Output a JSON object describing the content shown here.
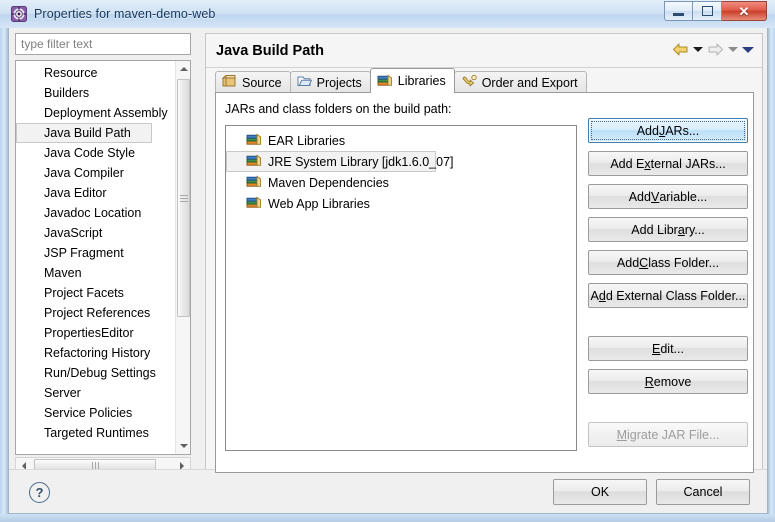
{
  "window": {
    "title": "Properties for maven-demo-web",
    "icon": "properties-gear-icon",
    "minimize_label": "–",
    "maximize_label": "□",
    "close_label": "✕"
  },
  "sidebar": {
    "filter_placeholder": "type filter text",
    "filter_value": "",
    "selected": "Java Build Path",
    "items": [
      {
        "label": "Resource"
      },
      {
        "label": "Builders"
      },
      {
        "label": "Deployment Assembly"
      },
      {
        "label": "Java Build Path"
      },
      {
        "label": "Java Code Style"
      },
      {
        "label": "Java Compiler"
      },
      {
        "label": "Java Editor"
      },
      {
        "label": "Javadoc Location"
      },
      {
        "label": "JavaScript"
      },
      {
        "label": "JSP Fragment"
      },
      {
        "label": "Maven"
      },
      {
        "label": "Project Facets"
      },
      {
        "label": "Project References"
      },
      {
        "label": "PropertiesEditor"
      },
      {
        "label": "Refactoring History"
      },
      {
        "label": "Run/Debug Settings"
      },
      {
        "label": "Server"
      },
      {
        "label": "Service Policies"
      },
      {
        "label": "Targeted Runtimes"
      }
    ]
  },
  "page": {
    "title": "Java Build Path",
    "nav": {
      "back": "back-arrow",
      "back_menu": "back-dropdown",
      "forward": "forward-arrow",
      "forward_menu": "forward-dropdown",
      "more": "more-dropdown"
    },
    "tabs": [
      {
        "label": "Source",
        "icon": "source-package-icon",
        "active": false
      },
      {
        "label": "Projects",
        "icon": "open-folder-icon",
        "active": false
      },
      {
        "label": "Libraries",
        "icon": "books-icon",
        "active": true
      },
      {
        "label": "Order and Export",
        "icon": "order-export-icon",
        "active": false
      }
    ],
    "panel_label": "JARs and class folders on the build path:",
    "libraries": [
      {
        "label": "EAR Libraries",
        "icon": "library-books-icon",
        "selected": false
      },
      {
        "label": "JRE System Library [jdk1.6.0_07]",
        "icon": "library-books-icon",
        "selected": true
      },
      {
        "label": "Maven Dependencies",
        "icon": "library-books-icon",
        "selected": false
      },
      {
        "label": "Web App Libraries",
        "icon": "library-books-icon",
        "selected": false
      }
    ],
    "buttons": [
      {
        "label": "Add JARs...",
        "mnemonic": "J",
        "state": "focused"
      },
      {
        "label": "Add External JARs...",
        "mnemonic": "x",
        "state": "normal"
      },
      {
        "label": "Add Variable...",
        "mnemonic": "V",
        "state": "normal"
      },
      {
        "label": "Add Library...",
        "mnemonic": "a",
        "state": "normal"
      },
      {
        "label": "Add Class Folder...",
        "mnemonic": "C",
        "state": "normal"
      },
      {
        "label": "Add External Class Folder...",
        "mnemonic": "d",
        "state": "normal"
      },
      {
        "label": "Edit...",
        "mnemonic": "E",
        "state": "normal"
      },
      {
        "label": "Remove",
        "mnemonic": "R",
        "state": "normal"
      },
      {
        "label": "Migrate JAR File...",
        "mnemonic": "M",
        "state": "disabled"
      }
    ]
  },
  "footer": {
    "help_label": "?",
    "ok_label": "OK",
    "cancel_label": "Cancel"
  },
  "colors": {
    "title_text": "#14355c",
    "close_button": "#c93f2c",
    "focus_border": "#3c7fb1",
    "selection_bg": "#f2f2f2"
  }
}
